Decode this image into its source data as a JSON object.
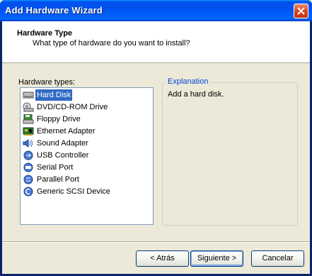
{
  "window": {
    "title": "Add Hardware Wizard"
  },
  "header": {
    "title": "Hardware Type",
    "subtitle": "What type of hardware do you want to install?"
  },
  "hardware_list": {
    "label": "Hardware types:",
    "items": [
      {
        "label": "Hard Disk",
        "icon": "hard-disk-icon",
        "selected": true
      },
      {
        "label": "DVD/CD-ROM Drive",
        "icon": "dvd-drive-icon",
        "selected": false
      },
      {
        "label": "Floppy Drive",
        "icon": "floppy-drive-icon",
        "selected": false
      },
      {
        "label": "Ethernet Adapter",
        "icon": "ethernet-adapter-icon",
        "selected": false
      },
      {
        "label": "Sound Adapter",
        "icon": "sound-adapter-icon",
        "selected": false
      },
      {
        "label": "USB Controller",
        "icon": "usb-controller-icon",
        "selected": false
      },
      {
        "label": "Serial Port",
        "icon": "serial-port-icon",
        "selected": false
      },
      {
        "label": "Parallel Port",
        "icon": "parallel-port-icon",
        "selected": false
      },
      {
        "label": "Generic SCSI Device",
        "icon": "scsi-device-icon",
        "selected": false
      }
    ]
  },
  "explanation": {
    "legend": "Explanation",
    "text": "Add a hard disk."
  },
  "buttons": {
    "back": "< Atrás",
    "next": "Siguiente >",
    "cancel": "Cancelar"
  },
  "colors": {
    "selection": "#316ac5",
    "legend": "#0046d5",
    "titlebar": "#0053ee"
  }
}
